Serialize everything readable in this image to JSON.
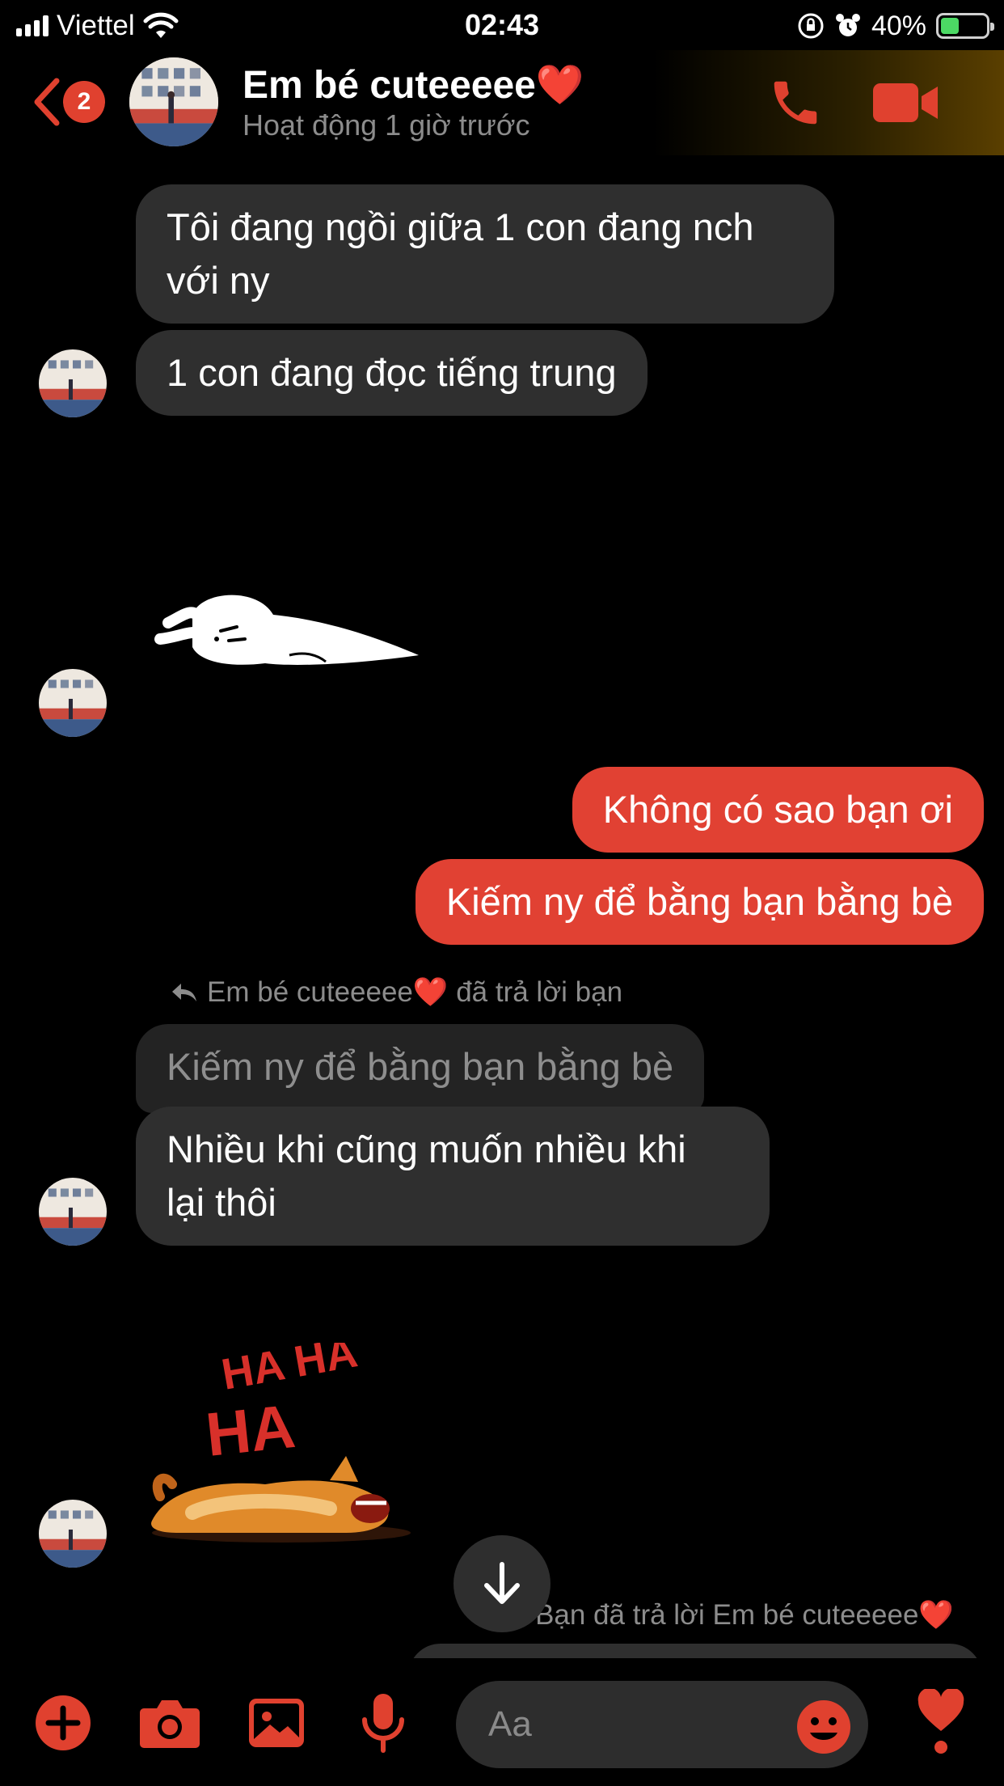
{
  "status_bar": {
    "carrier": "Viettel",
    "time": "02:43",
    "battery_percent": "40%",
    "battery_level": 0.4
  },
  "header": {
    "unread_count": "2",
    "contact_name": "Em bé cuteeeee❤️",
    "active_status": "Hoạt động 1 giờ trước",
    "accent_color": "#e0412f"
  },
  "messages": {
    "m1_line1": "Tôi đang ngồi giữa 1 con đang nch",
    "m1_line2": "với ny",
    "m2": "1 con đang đọc tiếng trung",
    "m3": "Không có sao bạn ơi",
    "m4": "Kiếm ny để bằng bạn bằng bè",
    "reply1_label": "Em bé cuteeeee❤️ đã trả lời bạn",
    "quoted": "Kiếm ny để bằng bạn bằng bè",
    "m5_line1": "Nhiều khi cũng muốn nhiều khi",
    "m5_line2": "lại thôi",
    "reply2_label": "Bạn đã trả lời Em bé cuteeeee❤️"
  },
  "stickers": {
    "sticker2_text": "HA HA"
  },
  "composer": {
    "placeholder": "Aa"
  },
  "colors": {
    "incoming_bubble": "#2f2f2f",
    "outgoing_bubble": "#e14133",
    "background": "#000000"
  }
}
